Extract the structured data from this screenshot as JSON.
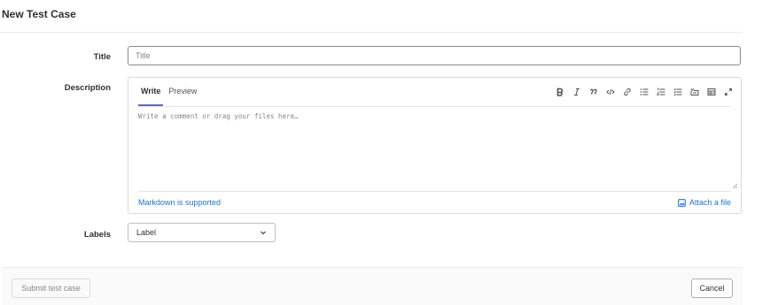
{
  "page": {
    "title": "New Test Case"
  },
  "form": {
    "title_field": {
      "label": "Title",
      "placeholder": "Title",
      "value": ""
    },
    "description": {
      "label": "Description",
      "tabs": [
        {
          "label": "Write",
          "active": true
        },
        {
          "label": "Preview",
          "active": false
        }
      ],
      "toolbar": [
        {
          "icon": "bold-icon",
          "glyph": "B"
        },
        {
          "icon": "italic-icon",
          "glyph": "I"
        },
        {
          "icon": "quote-icon",
          "glyph": "99"
        },
        {
          "icon": "code-icon",
          "glyph": "</>"
        },
        {
          "icon": "link-icon",
          "glyph": "link"
        },
        {
          "icon": "bulleted-list-icon",
          "glyph": "ul"
        },
        {
          "icon": "numbered-list-icon",
          "glyph": "ol"
        },
        {
          "icon": "task-list-icon",
          "glyph": "tl"
        },
        {
          "icon": "collapsible-section-icon",
          "glyph": "cs"
        },
        {
          "icon": "table-icon",
          "glyph": "tb"
        },
        {
          "icon": "fullscreen-icon",
          "glyph": "fs"
        }
      ],
      "placeholder": "Write a comment or drag your files here…",
      "markdown_link": "Markdown is supported",
      "attach_link": "Attach a file"
    },
    "labels": {
      "label": "Labels",
      "dropdown_value": "Label"
    }
  },
  "footer": {
    "submit_label": "Submit test case",
    "cancel_label": "Cancel",
    "submit_disabled": true
  },
  "colors": {
    "accent": "#6666c4",
    "link": "#1f75cb",
    "text": "#303030"
  }
}
